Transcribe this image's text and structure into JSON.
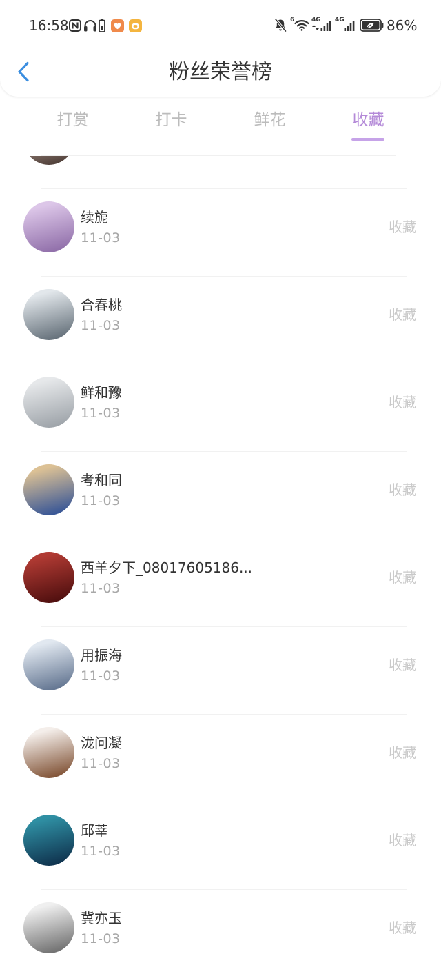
{
  "status_bar": {
    "time": "16:58",
    "wifi_badge": "6",
    "network_1": "4G",
    "network_2": "4G",
    "battery_percent": "86%",
    "icons_left": [
      "nfc-icon",
      "headphones-icon",
      "battery-saver-icon",
      "app-notification-icon",
      "app-notification-icon"
    ],
    "icons_right": [
      "mute-icon",
      "wifi-icon",
      "signal-icon",
      "signal-icon",
      "battery-icon"
    ]
  },
  "header": {
    "back_icon": "chevron-left-icon",
    "title": "粉丝荣誉榜"
  },
  "tabs": [
    {
      "label": "打赏",
      "active": false
    },
    {
      "label": "打卡",
      "active": false
    },
    {
      "label": "鲜花",
      "active": false
    },
    {
      "label": "收藏",
      "active": true
    }
  ],
  "colors": {
    "accent": "#b48ad8",
    "accent_underline": "#c6a3e8",
    "back_icon": "#3b8ee0",
    "text_primary": "#333333",
    "text_secondary": "#a8a8a8",
    "action_text": "#c9c9c9",
    "tab_inactive": "#bcbcbc"
  },
  "list": {
    "partial_item": {
      "avatar_colors": [
        "#cdb8ab",
        "#4a3a34"
      ]
    },
    "items": [
      {
        "name": "续旎",
        "date": "11-03",
        "action": "收藏",
        "avatar_colors": [
          "#dcc6e8",
          "#8c6aa6"
        ]
      },
      {
        "name": "合春桃",
        "date": "11-03",
        "action": "收藏",
        "avatar_colors": [
          "#e2e7eb",
          "#5e6a74"
        ]
      },
      {
        "name": "鲜和豫",
        "date": "11-03",
        "action": "收藏",
        "avatar_colors": [
          "#e6e8ea",
          "#9aa0a6"
        ]
      },
      {
        "name": "考和同",
        "date": "11-03",
        "action": "收藏",
        "avatar_colors": [
          "#dcc195",
          "#2d4f96"
        ]
      },
      {
        "name": "西羊夕下_08017605186...",
        "date": "11-03",
        "action": "收藏",
        "avatar_colors": [
          "#b03a33",
          "#4a0d0d"
        ]
      },
      {
        "name": "用振海",
        "date": "11-03",
        "action": "收藏",
        "avatar_colors": [
          "#e1e8f0",
          "#5c6f8c"
        ]
      },
      {
        "name": "泷问凝",
        "date": "11-03",
        "action": "收藏",
        "avatar_colors": [
          "#f4eeea",
          "#7b4b2d"
        ]
      },
      {
        "name": "邱莘",
        "date": "11-03",
        "action": "收藏",
        "avatar_colors": [
          "#2f8fa3",
          "#0e2e4a"
        ]
      },
      {
        "name": "冀亦玉",
        "date": "11-03",
        "action": "收藏",
        "avatar_colors": [
          "#efefef",
          "#6a6a6a"
        ]
      }
    ]
  }
}
